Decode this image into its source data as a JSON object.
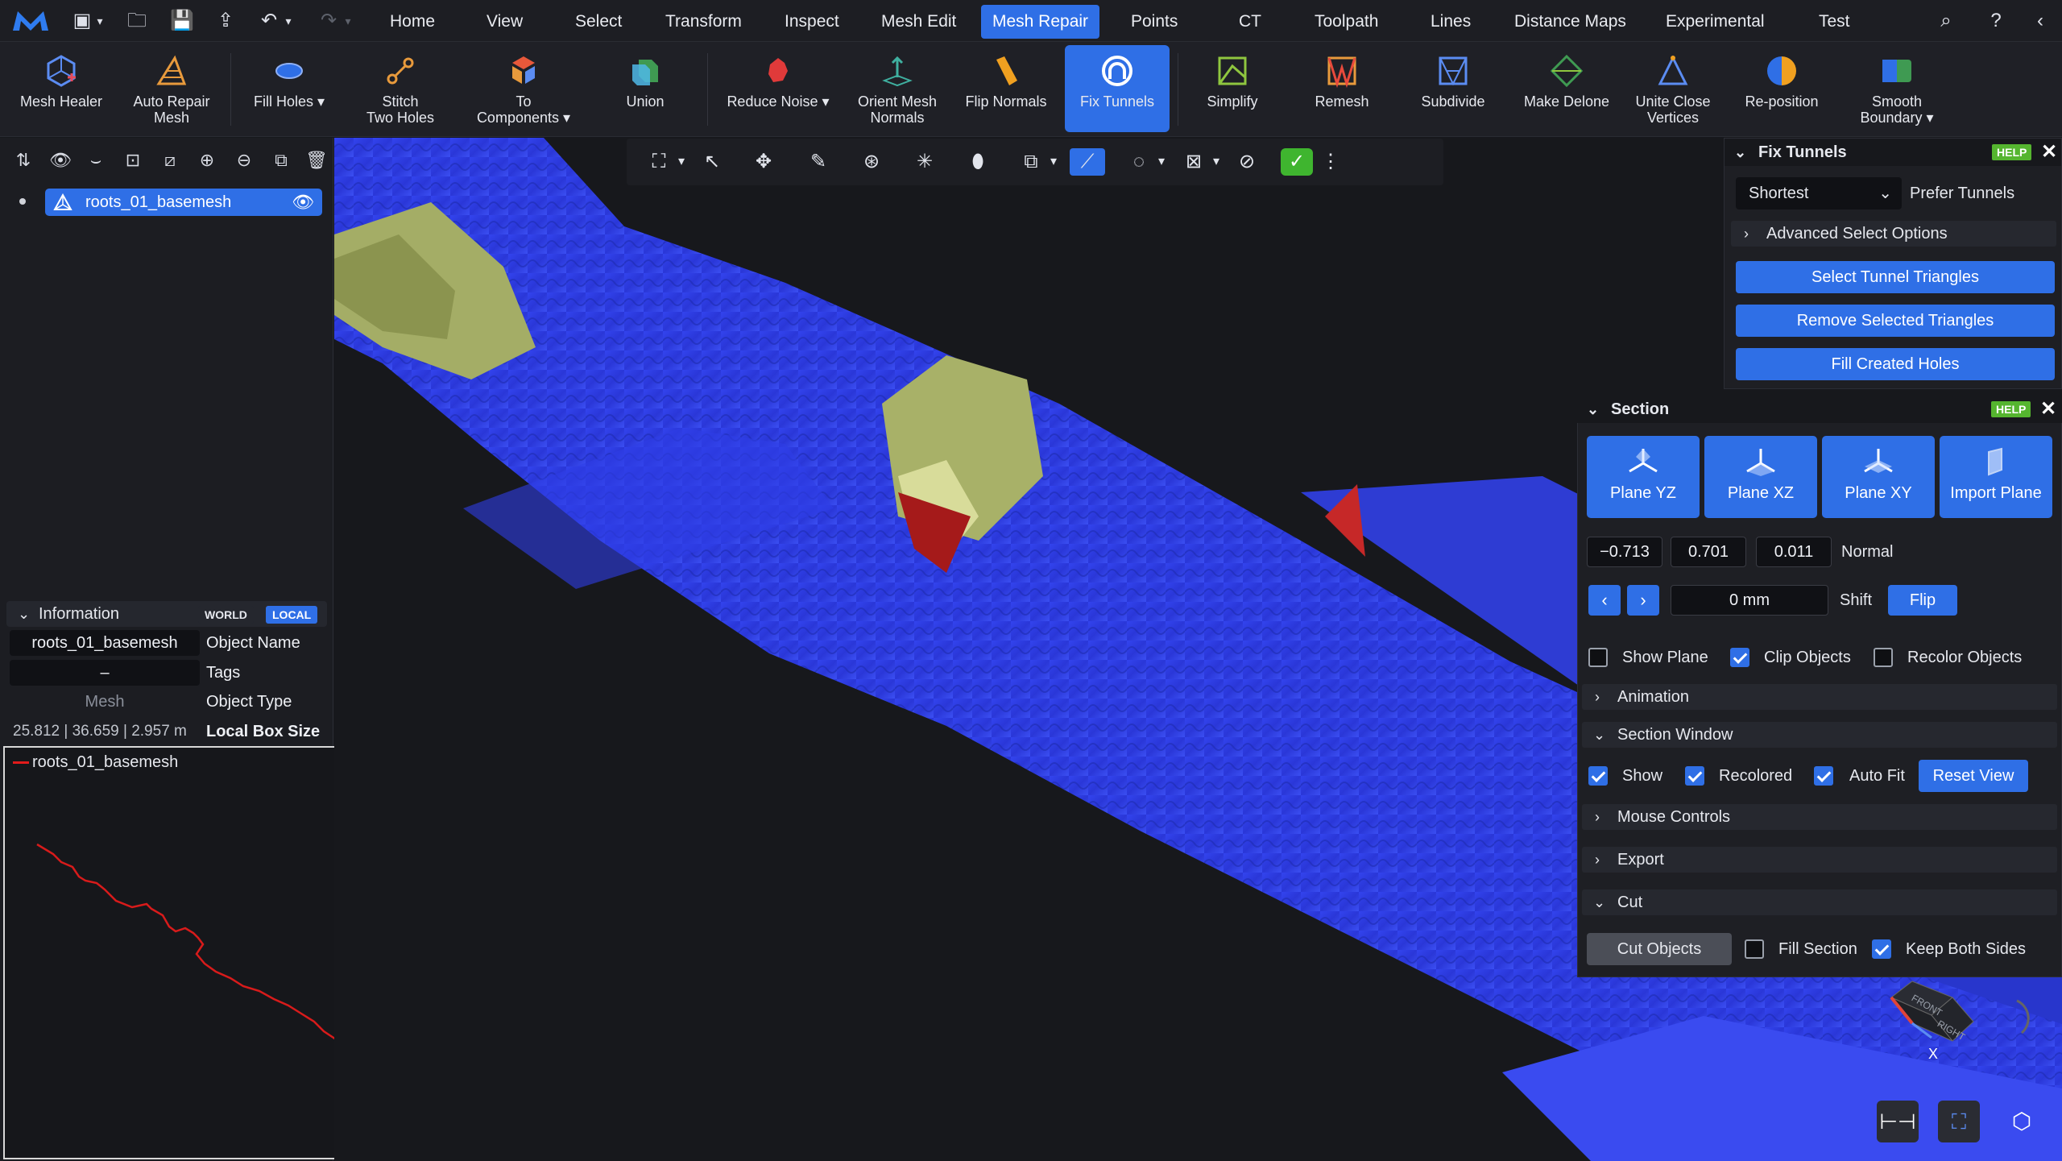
{
  "menu": {
    "tabs": [
      "Home",
      "View",
      "Select",
      "Transform",
      "Inspect",
      "Mesh Edit",
      "Mesh Repair",
      "Points",
      "CT",
      "Toolpath",
      "Lines",
      "Distance Maps",
      "Experimental",
      "Test"
    ],
    "active_tab": "Mesh Repair"
  },
  "ribbon": {
    "tools": [
      {
        "label": "Mesh Healer",
        "icon": "mesh-healer-icon"
      },
      {
        "label": "Auto Repair Mesh",
        "icon": "auto-repair-icon"
      },
      {
        "label": "Fill Holes",
        "icon": "fill-holes-icon"
      },
      {
        "label": "Stitch Two Holes",
        "icon": "stitch-icon"
      },
      {
        "label": "To Components",
        "icon": "components-icon"
      },
      {
        "label": "Union",
        "icon": "union-icon"
      },
      {
        "label": "Reduce Noise",
        "icon": "reduce-noise-icon"
      },
      {
        "label": "Orient Mesh Normals",
        "icon": "orient-normals-icon"
      },
      {
        "label": "Flip Normals",
        "icon": "flip-normals-icon"
      },
      {
        "label": "Fix Tunnels",
        "icon": "fix-tunnels-icon"
      },
      {
        "label": "Simplify",
        "icon": "simplify-icon"
      },
      {
        "label": "Remesh",
        "icon": "remesh-icon"
      },
      {
        "label": "Subdivide",
        "icon": "subdivide-icon"
      },
      {
        "label": "Make Delone",
        "icon": "make-delone-icon"
      },
      {
        "label": "Unite Close Vertices",
        "icon": "unite-vertices-icon"
      },
      {
        "label": "Re-position",
        "icon": "reposition-icon"
      },
      {
        "label": "Smooth Boundary",
        "icon": "smooth-boundary-icon"
      }
    ],
    "active_tool": "Fix Tunnels"
  },
  "scene": {
    "object_name": "roots_01_basemesh"
  },
  "information": {
    "title": "Information",
    "world": "WORLD",
    "local": "LOCAL",
    "object_name_value": "roots_01_basemesh",
    "object_name_label": "Object Name",
    "tags_value": "–",
    "tags_label": "Tags",
    "type_value": "Mesh",
    "type_label": "Object Type",
    "box_value": "25.812 | 36.659 | 2.957 m",
    "box_label": "Local Box Size"
  },
  "section_window": {
    "legend": "roots_01_basemesh",
    "scale_1": "1",
    "scale_2": "2"
  },
  "fix_tunnels": {
    "title": "Fix Tunnels",
    "help": "HELP",
    "mode": "Shortest",
    "mode_label": "Prefer Tunnels",
    "advanced": "Advanced Select Options",
    "btn_select": "Select Tunnel Triangles",
    "btn_remove": "Remove Selected Triangles",
    "btn_fill": "Fill Created Holes"
  },
  "section": {
    "title": "Section",
    "help": "HELP",
    "planes": [
      "Plane YZ",
      "Plane XZ",
      "Plane XY",
      "Import Plane"
    ],
    "normal_x": "−0.713",
    "normal_y": "0.701",
    "normal_z": "0.011",
    "normal_label": "Normal",
    "shift_value": "0 mm",
    "shift_label": "Shift",
    "flip": "Flip",
    "show_plane": "Show Plane",
    "clip_objects": "Clip Objects",
    "recolor_objects": "Recolor Objects",
    "animation": "Animation",
    "section_window": "Section Window",
    "show": "Show",
    "recolored": "Recolored",
    "auto_fit": "Auto Fit",
    "reset_view": "Reset View",
    "mouse_controls": "Mouse Controls",
    "export": "Export",
    "cut": "Cut",
    "cut_objects": "Cut Objects",
    "fill_section": "Fill Section",
    "keep_both": "Keep Both Sides"
  },
  "viewcube": {
    "front": "FRONT",
    "right": "RIGHT",
    "axis": "X"
  },
  "colors": {
    "accent": "#2f6fe6",
    "mesh": "#2d3ff0",
    "help": "#55b52f"
  }
}
